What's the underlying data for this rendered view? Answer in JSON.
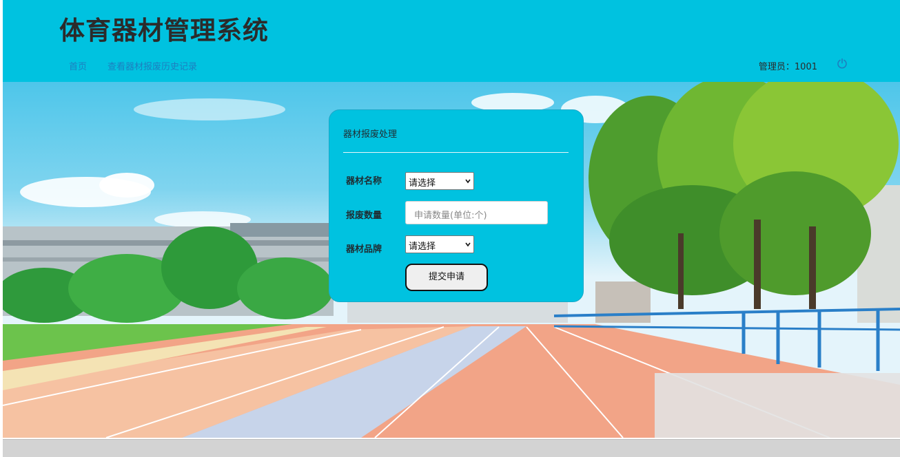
{
  "header": {
    "title": "体育器材管理系统",
    "nav": [
      {
        "label": "首页"
      },
      {
        "label": "查看器材报废历史记录"
      }
    ],
    "user_label": "管理员：1001",
    "power_icon": "power-icon"
  },
  "form": {
    "title": "器材报废处理",
    "fields": {
      "equipment_name": {
        "label": "器材名称",
        "value": "请选择"
      },
      "scrap_quantity": {
        "label": "报废数量",
        "placeholder": "申请数量(单位:个)"
      },
      "equipment_brand": {
        "label": "器材品牌",
        "value": "请选择"
      }
    },
    "submit_label": "提交申请"
  },
  "colors": {
    "header_bg": "#00c2e0",
    "panel_bg": "#00c2e0",
    "nav_link": "#1d7fbf",
    "footer_bg": "#d3d3d3"
  }
}
